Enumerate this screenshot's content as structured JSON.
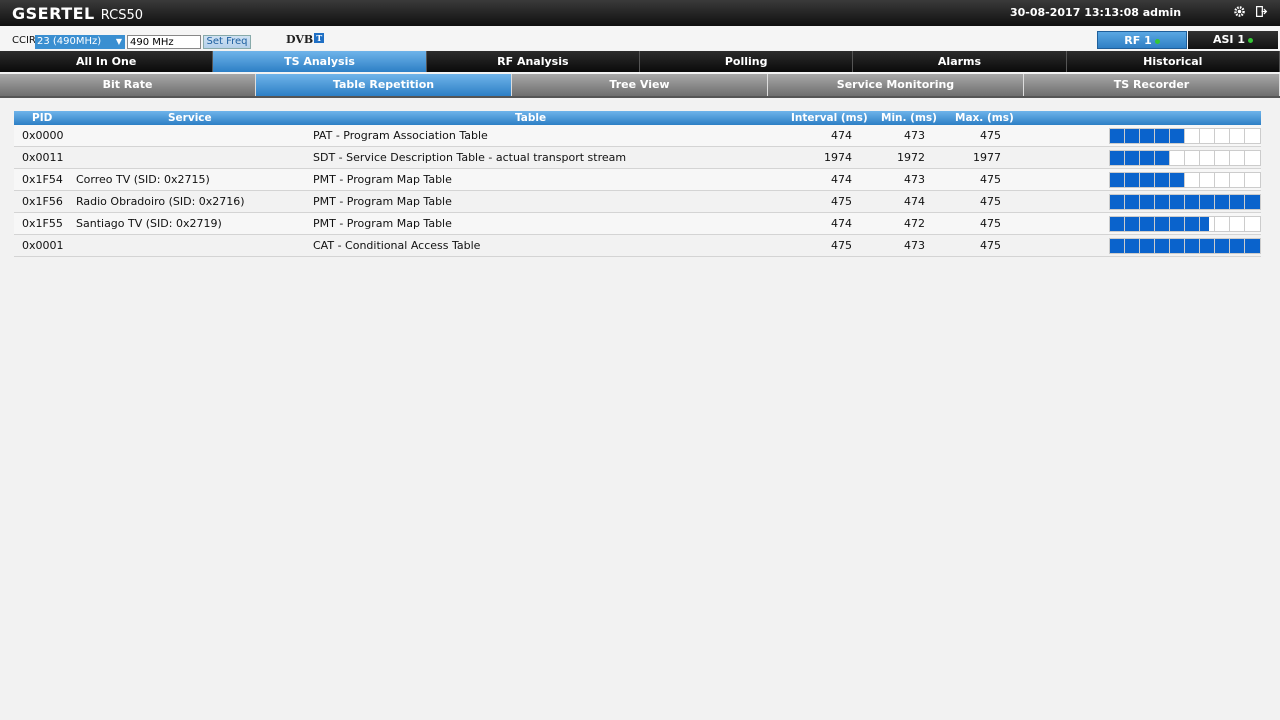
{
  "header": {
    "brand": "GSERTEL",
    "model": "RCS50",
    "datetime": "30-08-2017 13:13:08 admin"
  },
  "controls": {
    "ccir_label": "CCIR",
    "ccir_selected": "23 (490MHz)",
    "freq_value": "490 MHz",
    "set_freq_label": "Set Freq",
    "dvb_logo": "DVB",
    "dvb_badge": "T",
    "rf_label": "RF 1",
    "asi_label": "ASI 1"
  },
  "main_tabs": [
    {
      "label": "All In One",
      "active": false
    },
    {
      "label": "TS Analysis",
      "active": true
    },
    {
      "label": "RF Analysis",
      "active": false
    },
    {
      "label": "Polling",
      "active": false
    },
    {
      "label": "Alarms",
      "active": false
    },
    {
      "label": "Historical",
      "active": false
    }
  ],
  "sub_tabs": [
    {
      "label": "Bit Rate",
      "active": false
    },
    {
      "label": "Table Repetition",
      "active": true
    },
    {
      "label": "Tree View",
      "active": false
    },
    {
      "label": "Service Monitoring",
      "active": false
    },
    {
      "label": "TS Recorder",
      "active": false
    }
  ],
  "table": {
    "columns": {
      "pid": "PID",
      "service": "Service",
      "table": "Table",
      "interval": "Interval (ms)",
      "min": "Min. (ms)",
      "max": "Max. (ms)"
    },
    "rows": [
      {
        "pid": "0x0000",
        "service": "",
        "table": "PAT - Program Association Table",
        "interval": "474",
        "min": "473",
        "max": "475",
        "level": 0.5
      },
      {
        "pid": "0x0011",
        "service": "",
        "table": "SDT - Service Description Table - actual transport stream",
        "interval": "1974",
        "min": "1972",
        "max": "1977",
        "level": 0.4
      },
      {
        "pid": "0x1F54",
        "service": "Correo TV (SID: 0x2715)",
        "table": "PMT - Program Map Table",
        "interval": "474",
        "min": "473",
        "max": "475",
        "level": 0.5
      },
      {
        "pid": "0x1F56",
        "service": "Radio Obradoiro (SID: 0x2716)",
        "table": "PMT - Program Map Table",
        "interval": "475",
        "min": "474",
        "max": "475",
        "level": 1.0
      },
      {
        "pid": "0x1F55",
        "service": "Santiago TV (SID: 0x2719)",
        "table": "PMT - Program Map Table",
        "interval": "474",
        "min": "472",
        "max": "475",
        "level": 0.66
      },
      {
        "pid": "0x0001",
        "service": "",
        "table": "CAT - Conditional Access Table",
        "interval": "475",
        "min": "473",
        "max": "475",
        "level": 1.0
      }
    ]
  },
  "colors": {
    "accent": "#2d7fc5",
    "bar_fill": "#0a63cc",
    "status_ok": "#35c735"
  },
  "icons": {
    "settings": "gear-icon",
    "logout": "logout-icon"
  }
}
